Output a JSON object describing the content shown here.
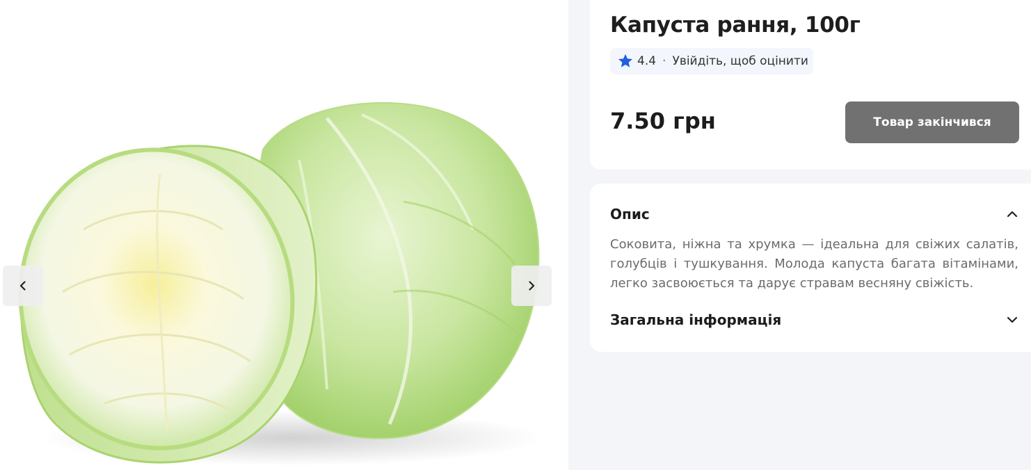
{
  "gallery": {
    "image_alt": "Капуста рання, 100г",
    "prev_icon": "chevron-left-icon",
    "next_icon": "chevron-right-icon"
  },
  "product": {
    "title": "Капуста рання, 100г",
    "rating": "4.4",
    "rating_separator": "·",
    "rating_cta": "Увійдіть, щоб оцінити",
    "price": "7.50 грн",
    "button_label": "Товар закінчився"
  },
  "colors": {
    "star": "#1f5fe0",
    "button_bg": "#717171",
    "page_bg": "#f4f5f8"
  },
  "sections": {
    "description_title": "Опис",
    "description_text": "Соковита, ніжна та хрумка — ідеальна для свіжих салатів, голубців і тушкування. Молода капуста багата вітамінами, легко засвоюється та дарує стравам весняну свіжість.",
    "info_title": "Загальна інформація"
  }
}
